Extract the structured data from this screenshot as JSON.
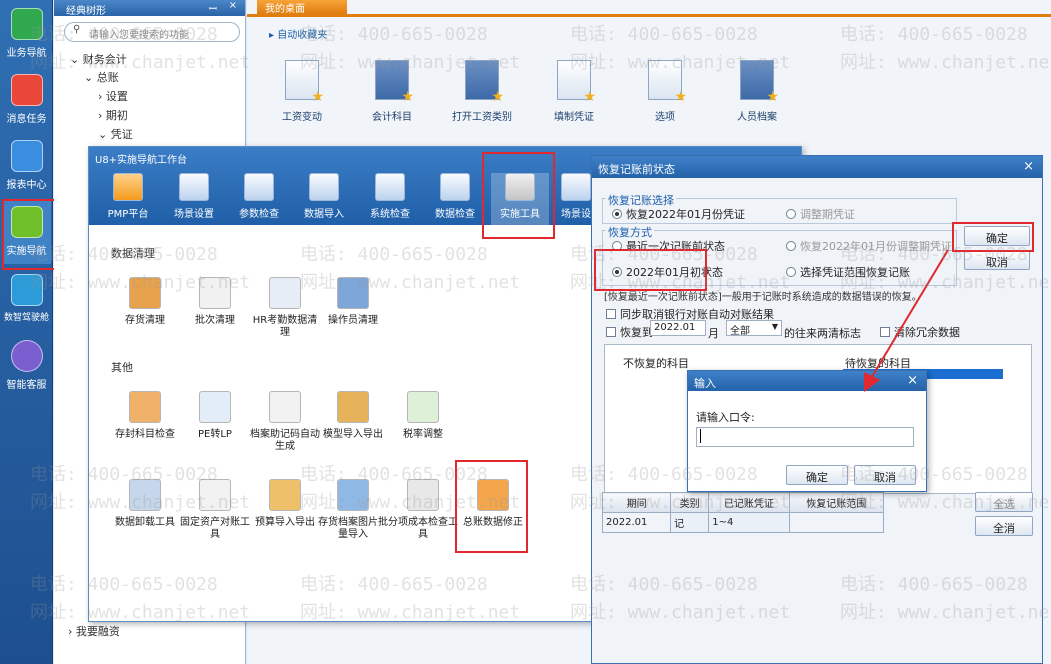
{
  "rail": {
    "items": [
      {
        "label": "业务导航",
        "icon": "business-nav-icon",
        "color": "#2fa84f"
      },
      {
        "label": "消息任务",
        "icon": "message-task-icon",
        "color": "#e8473a"
      },
      {
        "label": "报表中心",
        "icon": "report-center-icon",
        "color": "#3b8de0"
      },
      {
        "label": "实施导航",
        "icon": "implement-nav-icon",
        "color": "#6fbf2b"
      },
      {
        "label": "数智驾驶舱",
        "icon": "cockpit-icon",
        "color": "#2c9bd8"
      },
      {
        "label": "智能客服",
        "icon": "smart-service-icon",
        "color": "#7a5fd0"
      }
    ]
  },
  "tree": {
    "title": "经典树形",
    "pin": "ꟷ",
    "close": "×",
    "search_placeholder": "请输入您要搜索的功能",
    "nodes": [
      "财务会计",
      "总账",
      "设置",
      "期初",
      "凭证"
    ],
    "bottom_nodes": [
      "我要融资"
    ]
  },
  "desktop": {
    "tab": "我的桌面",
    "fav_title": "自动收藏夹",
    "fav_items": [
      "工资变动",
      "会计科目",
      "打开工资类别",
      "填制凭证",
      "选项",
      "人员档案"
    ]
  },
  "u8": {
    "title": "U8+实施导航工作台",
    "toolbar": [
      "PMP平台",
      "场景设置",
      "参数检查",
      "数据导入",
      "系统检查",
      "数据检查",
      "实施工具",
      "场景设"
    ],
    "section1": "数据清理",
    "section1_items": [
      "存货清理",
      "批次清理",
      "HR考勤数据清理",
      "操作员清理"
    ],
    "section2": "其他",
    "section2_row1": [
      "存封科目检查",
      "PE转LP",
      "档案助记码自动生成",
      "模型导入导出",
      "税率调整"
    ],
    "section2_row2": [
      "数据卸载工具",
      "固定资产对账工具",
      "预算导入导出",
      "存货档案图片批量导入",
      "分项成本检查工具",
      "总账数据修正"
    ]
  },
  "restore": {
    "title": "恢复记账前状态",
    "close": "×",
    "group1": "恢复记账选择",
    "opt_voucher": "恢复2022年01月份凭证",
    "opt_adjust": "调整期凭证",
    "group2": "恢复方式",
    "opt_recent": "最近一次记账前状态",
    "opt_restore_adjust": "恢复2022年01月份调整期凭证",
    "opt_initial": "2022年01月初状态",
    "opt_select": "选择凭证范围恢复记账",
    "btn_ok": "确定",
    "btn_cancel": "取消",
    "note": "[恢复最近一次记账前状态]一般用于记账时系统造成的数据错误的恢复。",
    "chk_sync": "同步取消银行对账自动对账结果",
    "chk_restore_to": "恢复到",
    "sel_month": "2022.01",
    "month_label": "月",
    "sel_all": "全部",
    "flag_label": "的往来两清标志",
    "chk_clear": "清除冗余数据",
    "col_not_restore": "不恢复的科目",
    "col_to_restore": "待恢复的科目",
    "table_headers": [
      "期间",
      "类别",
      "已记账凭证",
      "恢复记账范围"
    ],
    "table_rows": [
      [
        "2022.01",
        "记",
        "1~4",
        ""
      ]
    ],
    "btn_select_all": "全选",
    "btn_clear_all": "全消"
  },
  "input": {
    "title": "输入",
    "close": "×",
    "prompt": "请输入口令:",
    "value": "",
    "btn_ok": "确定",
    "btn_cancel": "取消"
  },
  "watermark": {
    "phone": "电话: 400-665-0028",
    "site": "网址: www.chanjet.net"
  },
  "colors": {
    "highlight": "#e0282e",
    "titlebar": "#2462a9"
  }
}
